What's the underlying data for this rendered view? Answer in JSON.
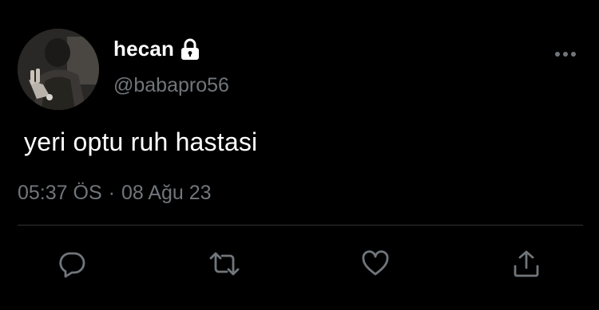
{
  "author": {
    "display_name": "hecan",
    "handle": "@babapro56",
    "protected_icon": "lock-icon",
    "avatar": "profile-photo"
  },
  "tweet": {
    "text": "yeri optu ruh hastasi",
    "time": "05:37 ÖS",
    "separator": "·",
    "date": "08 Ağu 23"
  },
  "actions": [
    {
      "name": "reply",
      "icon": "reply-icon"
    },
    {
      "name": "retweet",
      "icon": "retweet-icon"
    },
    {
      "name": "like",
      "icon": "heart-icon"
    },
    {
      "name": "share",
      "icon": "share-icon"
    }
  ],
  "more_menu_icon": "more-icon",
  "colors": {
    "background": "#000000",
    "primary_text": "#ffffff",
    "secondary_text": "#71767b",
    "divider": "#2f3336",
    "icon": "#71767b"
  }
}
